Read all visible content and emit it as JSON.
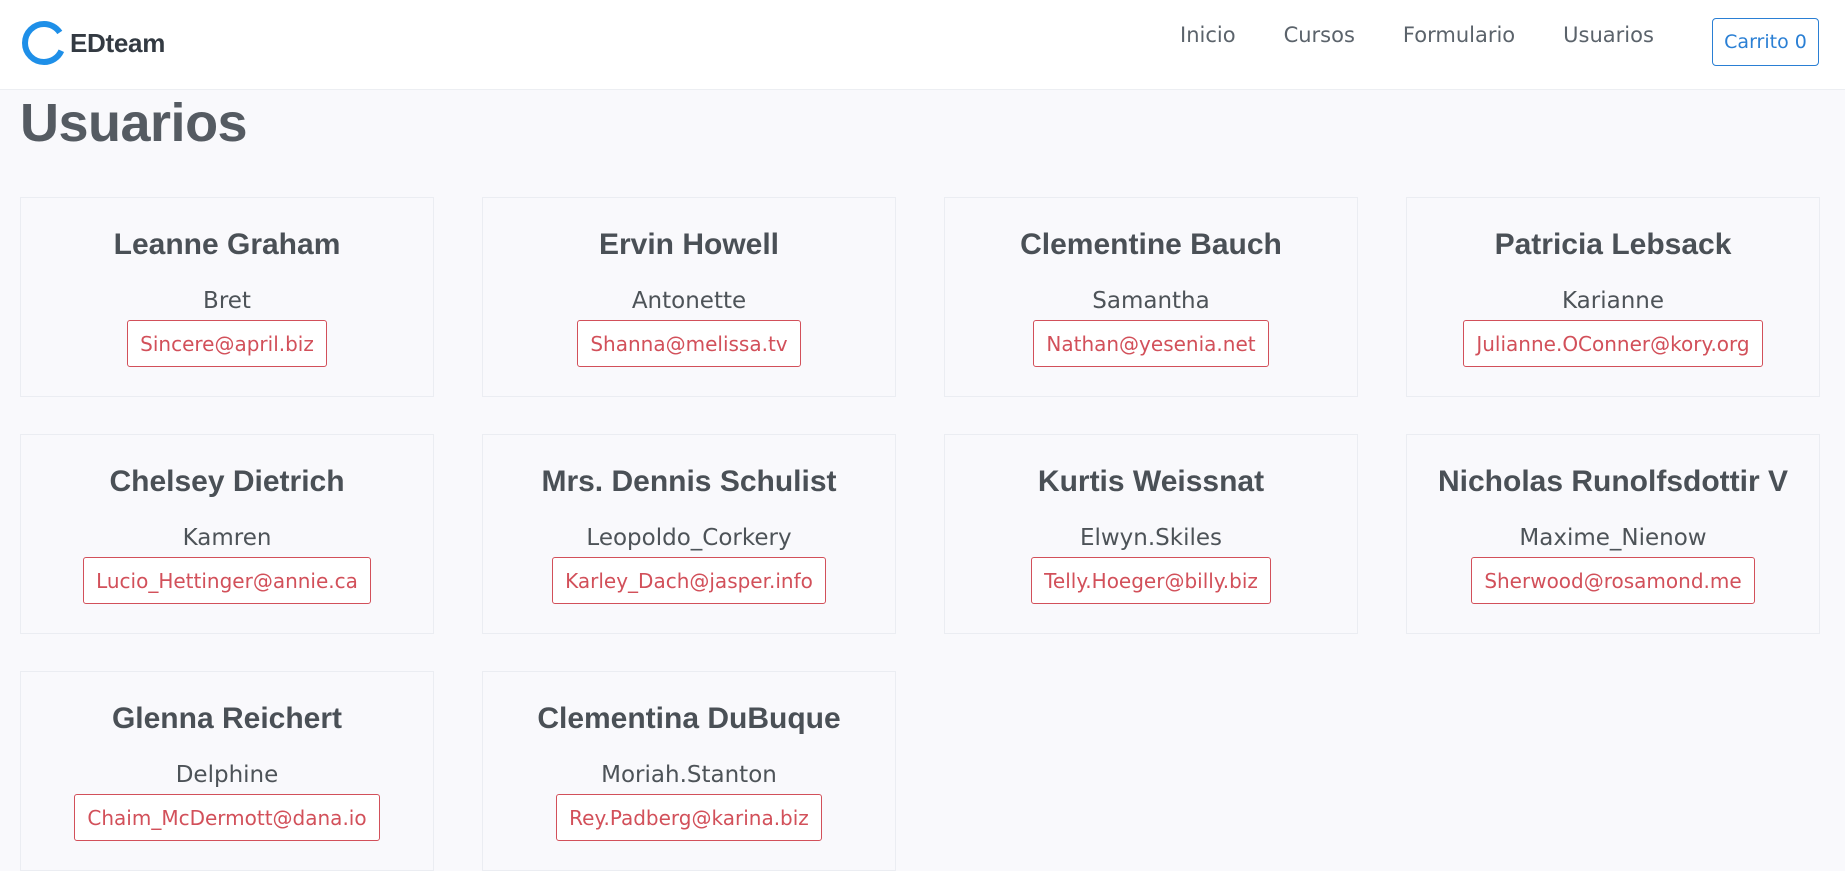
{
  "brand": {
    "name": "EDteam",
    "accent_color": "#1e8fe8"
  },
  "nav": {
    "items": [
      {
        "label": "Inicio"
      },
      {
        "label": "Cursos"
      },
      {
        "label": "Formulario"
      },
      {
        "label": "Usuarios"
      }
    ],
    "cart_label": "Carrito 0"
  },
  "page": {
    "title": "Usuarios"
  },
  "users": [
    {
      "name": "Leanne Graham",
      "username": "Bret",
      "email": "Sincere@april.biz"
    },
    {
      "name": "Ervin Howell",
      "username": "Antonette",
      "email": "Shanna@melissa.tv"
    },
    {
      "name": "Clementine Bauch",
      "username": "Samantha",
      "email": "Nathan@yesenia.net"
    },
    {
      "name": "Patricia Lebsack",
      "username": "Karianne",
      "email": "Julianne.OConner@kory.org"
    },
    {
      "name": "Chelsey Dietrich",
      "username": "Kamren",
      "email": "Lucio_Hettinger@annie.ca"
    },
    {
      "name": "Mrs. Dennis Schulist",
      "username": "Leopoldo_Corkery",
      "email": "Karley_Dach@jasper.info"
    },
    {
      "name": "Kurtis Weissnat",
      "username": "Elwyn.Skiles",
      "email": "Telly.Hoeger@billy.biz"
    },
    {
      "name": "Nicholas Runolfsdottir V",
      "username": "Maxime_Nienow",
      "email": "Sherwood@rosamond.me"
    },
    {
      "name": "Glenna Reichert",
      "username": "Delphine",
      "email": "Chaim_McDermott@dana.io"
    },
    {
      "name": "Clementina DuBuque",
      "username": "Moriah.Stanton",
      "email": "Rey.Padberg@karina.biz"
    }
  ]
}
